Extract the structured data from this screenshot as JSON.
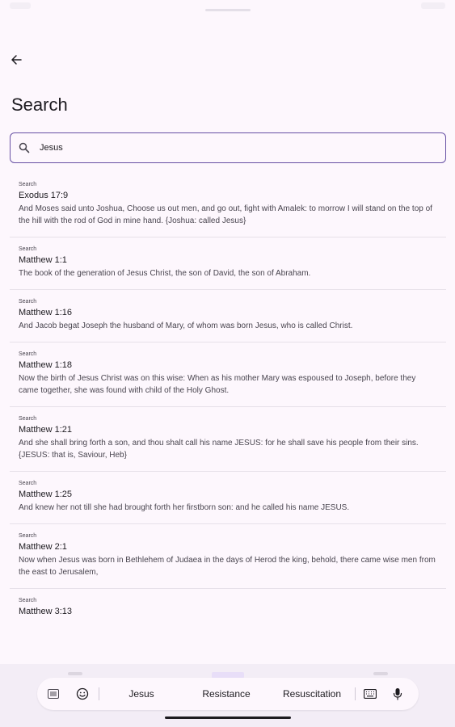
{
  "header": {
    "title": "Search"
  },
  "search": {
    "value": "Jesus"
  },
  "results": [
    {
      "tag": "Search",
      "ref": "Exodus 17:9",
      "text": "And Moses said unto Joshua, Choose us out men, and go out, fight with Amalek: to morrow I will stand on the top of the hill with the rod of God in mine hand. {Joshua: called Jesus}"
    },
    {
      "tag": "Search",
      "ref": "Matthew 1:1",
      "text": "The book of the generation of Jesus Christ, the son of David, the son of Abraham."
    },
    {
      "tag": "Search",
      "ref": "Matthew 1:16",
      "text": "And Jacob begat Joseph the husband of Mary, of whom was born Jesus, who is called Christ."
    },
    {
      "tag": "Search",
      "ref": "Matthew 1:18",
      "text": "Now the birth of Jesus Christ was on this wise: When as his mother Mary was espoused to Joseph, before they came together, she was found with child of the Holy Ghost."
    },
    {
      "tag": "Search",
      "ref": "Matthew 1:21",
      "text": "And she shall bring forth a son, and thou shalt call his name JESUS: for he shall save his people from their sins. {JESUS: that is, Saviour, Heb}"
    },
    {
      "tag": "Search",
      "ref": "Matthew 1:25",
      "text": "And knew her not till she had brought forth her firstborn son: and he called his name JESUS."
    },
    {
      "tag": "Search",
      "ref": "Matthew 2:1",
      "text": "Now when Jesus was born in Bethlehem of Judaea in the days of Herod the king, behold, there came wise men from the east to Jerusalem,"
    },
    {
      "tag": "Search",
      "ref": "Matthew 3:13",
      "text": ""
    }
  ],
  "keyboard": {
    "suggestions": [
      "Jesus",
      "Resistance",
      "Resuscitation"
    ],
    "icons": [
      "menu-grid-icon",
      "emoji-icon",
      "keyboard-icon",
      "microphone-icon"
    ]
  },
  "colors": {
    "accent": "#6750a4",
    "background": "#fdf7fd",
    "divider": "#e6e0e9"
  }
}
